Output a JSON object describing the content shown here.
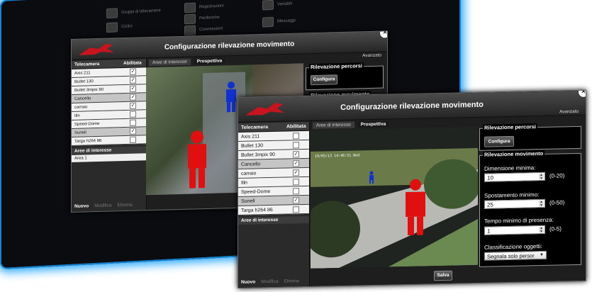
{
  "taskbar": {
    "items": [
      {
        "label": "Gruppi di telecamere",
        "icon": "camera-group-icon"
      },
      {
        "label": "Registrazioni",
        "icon": "recording-icon"
      },
      {
        "label": "Variabili",
        "icon": "variables-icon"
      },
      {
        "label": "Ciclici",
        "icon": "cycle-icon"
      },
      {
        "label": "Periferiche",
        "icon": "gear-icon"
      },
      {
        "label": "Connessioni",
        "icon": "gear-icon"
      },
      {
        "label": "Messaggi",
        "icon": "message-icon"
      }
    ]
  },
  "back_window": {
    "title": "Configurazione rilevazione movimento",
    "table": {
      "headers": [
        "Telecamera",
        "Abilitata"
      ],
      "rows": [
        {
          "name": "Axis 211",
          "checked": true
        },
        {
          "name": "Bullet 130",
          "checked": true
        },
        {
          "name": "Bullet 3mpix 90",
          "checked": true
        },
        {
          "name": "Cancello",
          "checked": true
        },
        {
          "name": "carraio",
          "checked": true
        },
        {
          "name": "Illn",
          "checked": false
        },
        {
          "name": "Speed-Dome",
          "checked": false
        },
        {
          "name": "Sunell",
          "checked": true
        },
        {
          "name": "Targa h264 86",
          "checked": false
        }
      ]
    },
    "areas_header": "Aree di interesse",
    "areas": [
      "Area 1"
    ],
    "bottom": {
      "new": "Nuovo",
      "edit": "Modifica",
      "delete": "Elimina"
    },
    "tabs": [
      "Aree di interesse",
      "Prospettiva"
    ],
    "advanced": "Avanzato",
    "paths_title": "Rilevazione percorsi",
    "config_button": "Configura",
    "motion_title": "Rilevazione movimento"
  },
  "front_window": {
    "title": "Configurazione rilevazione movimento",
    "table": {
      "headers": [
        "Telecamera",
        "Abilitata"
      ],
      "rows": [
        {
          "name": "Axis 211",
          "checked": false
        },
        {
          "name": "Bullet 130",
          "checked": false
        },
        {
          "name": "Bullet 3mpix 90",
          "checked": true
        },
        {
          "name": "Cancello",
          "checked": true
        },
        {
          "name": "carraio",
          "checked": true
        },
        {
          "name": "Illn",
          "checked": false
        },
        {
          "name": "Speed-Dome",
          "checked": false
        },
        {
          "name": "Sunell",
          "checked": true
        },
        {
          "name": "Targa h264 86",
          "checked": false
        }
      ]
    },
    "areas_header": "Aree di interesse",
    "bottom": {
      "new": "Nuovo",
      "edit": "Modifica",
      "delete": "Elimina"
    },
    "tabs": [
      "Aree di interesse",
      "Prospettiva"
    ],
    "advanced": "Avanzato",
    "timestamp": "19/05/13 14:46:51 Wed",
    "paths_title": "Rilevazione percorsi",
    "config_button": "Configura",
    "motion_title": "Rilevazione movimento",
    "fields": [
      {
        "label": "Dimensione minima:",
        "value": "10",
        "range": "(0-20)"
      },
      {
        "label": "Spostamento minimo:",
        "value": "25",
        "range": "(0-50)"
      },
      {
        "label": "Tempo minimo di presenza:",
        "value": "1",
        "range": "(0-5)"
      }
    ],
    "classification_label": "Classificazione oggetti:",
    "classification_value": "Segnala solo persor",
    "save_button": "Salva"
  },
  "colors": {
    "glow": "#1aa3ff",
    "person_red": "#e01010",
    "person_blue": "#1030d0"
  }
}
